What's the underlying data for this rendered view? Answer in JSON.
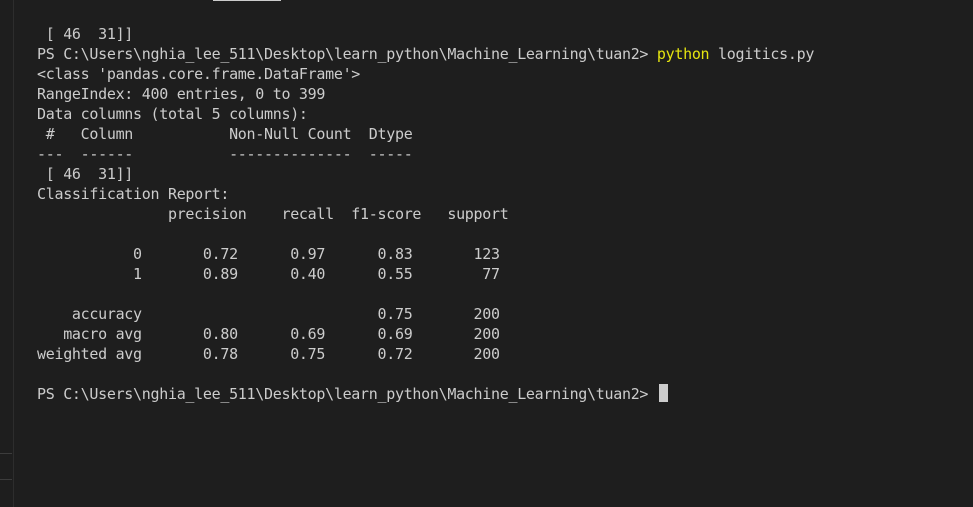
{
  "terminal": {
    "lines": [
      " [ 46  31]]",
      "",
      "<class 'pandas.core.frame.DataFrame'>",
      "RangeIndex: 400 entries, 0 to 399",
      "Data columns (total 5 columns):",
      " #   Column           Non-Null Count  Dtype ",
      "---  ------           --------------  ----- ",
      " [ 46  31]]",
      "Classification Report:",
      "               precision    recall  f1-score   support",
      "",
      "           0       0.72      0.97      0.83       123",
      "           1       0.89      0.40      0.55        77",
      "",
      "    accuracy                           0.75       200",
      "   macro avg       0.80      0.69      0.69       200",
      "weighted avg       0.78      0.75      0.72       200",
      ""
    ],
    "command_prompt": "PS C:\\Users\\nghia_lee_511\\Desktop\\learn_python\\Machine_Learning\\tuan2> ",
    "command_program": "python",
    "command_args": " logitics.py",
    "active_prompt": "PS C:\\Users\\nghia_lee_511\\Desktop\\learn_python\\Machine_Learning\\tuan2> "
  },
  "colors": {
    "background": "#1e1e1e",
    "text": "#cccccc",
    "command_highlight": "#e5e510"
  }
}
